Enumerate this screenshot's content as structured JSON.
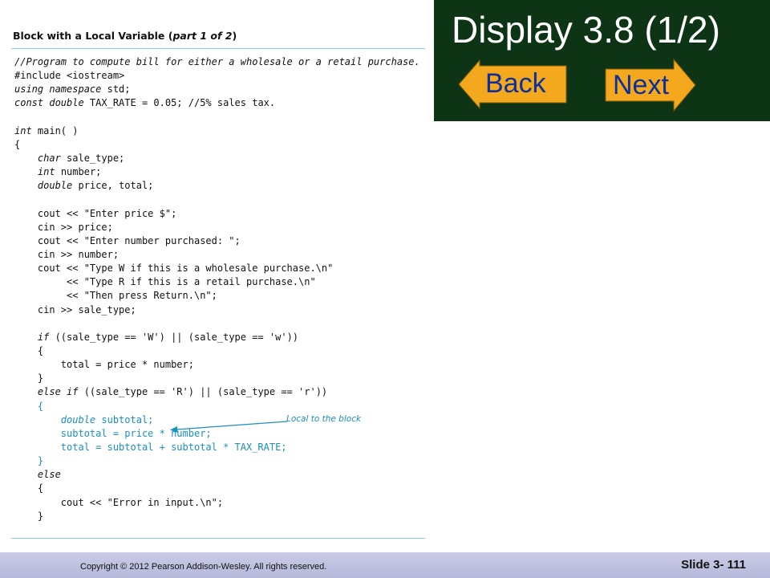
{
  "panel": {
    "title_main": "Block with a Local Variable (",
    "title_italic": "part 1 of 2",
    "title_end": ")"
  },
  "code": {
    "l1": "//Program to compute bill for either a wholesale or a retail purchase.",
    "l2": "#include <iostream>",
    "l3_kw": "using namespace",
    "l3_rest": " std;",
    "l4_kw": "const double",
    "l4_rest": " TAX_RATE = 0.05; //5% sales tax.",
    "l6_kw": "int",
    "l6_rest": " main( )",
    "l7": "{",
    "l8_indent": "    ",
    "l8_kw": "char",
    "l8_rest": " sale_type;",
    "l9_indent": "    ",
    "l9_kw": "int",
    "l9_rest": " number;",
    "l10_indent": "    ",
    "l10_kw": "double",
    "l10_rest": " price, total;",
    "l12": "    cout << \"Enter price $\";",
    "l13": "    cin >> price;",
    "l14": "    cout << \"Enter number purchased: \";",
    "l15": "    cin >> number;",
    "l16": "    cout << \"Type W if this is a wholesale purchase.\\n\"",
    "l17": "         << \"Type R if this is a retail purchase.\\n\"",
    "l18": "         << \"Then press Return.\\n\";",
    "l19": "    cin >> sale_type;",
    "l21_indent": "    ",
    "l21_kw": "if",
    "l21_rest": " ((sale_type == 'W') || (sale_type == 'w'))",
    "l22": "    {",
    "l23": "        total = price * number;",
    "l24": "    }",
    "l25_indent": "    ",
    "l25_kw": "else if",
    "l25_rest": " ((sale_type == 'R') || (sale_type == 'r'))",
    "l26": "    {",
    "l27_indent": "        ",
    "l27_kw": "double",
    "l27_rest": " subtotal;",
    "l28": "        subtotal = price * number;",
    "l29": "        total = subtotal + subtotal * TAX_RATE;",
    "l30": "    }",
    "l31_indent": "    ",
    "l31_kw": "else",
    "l32": "    {",
    "l33": "        cout << \"Error in input.\\n\";",
    "l34": "    }"
  },
  "annotation": {
    "label": "Local to the block"
  },
  "header": {
    "title": "Display 3.8  (1/2)",
    "back_label": "Back",
    "next_label": "Next"
  },
  "footer": {
    "copyright": "Copyright © 2012 Pearson Addison-Wesley.  All rights reserved.",
    "slide_number": "Slide 3- 111"
  },
  "colors": {
    "header_bg": "#0d3415",
    "button_fill": "#f4a81d",
    "button_text": "#0d2f9a",
    "code_highlight": "#1a8fc0",
    "footer_bg": "#c1c3e2"
  },
  "icons": {
    "back": "left-arrow-icon",
    "next": "right-arrow-icon"
  }
}
